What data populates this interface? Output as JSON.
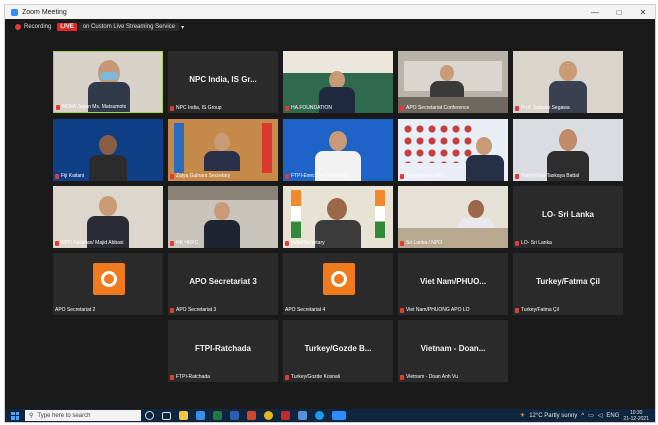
{
  "window": {
    "title": "Zoom Meeting",
    "minimize": "—",
    "maximize": "□",
    "close": "✕"
  },
  "toolbar": {
    "recording": "Recording",
    "live": "LIVE",
    "stream": "on Custom Live Streaming Service"
  },
  "tiles": [
    {
      "name": "MOFA Japan Ms. Matsumoto",
      "label": ""
    },
    {
      "name": "NPC India, IS Group",
      "label": "NPC India, IS Gr..."
    },
    {
      "name": "HA.FOUNDATION",
      "label": ""
    },
    {
      "name": "APO Secretariat Conference",
      "label": ""
    },
    {
      "name": "Prof. Sabano Segawa",
      "label": ""
    },
    {
      "name": "Fiji Kaitani",
      "label": ""
    },
    {
      "name": "Zaiya Gulnara Secretary",
      "label": ""
    },
    {
      "name": "FTPI-Executive Secretary",
      "label": ""
    },
    {
      "name": "Bangladesh-NPO",
      "label": ""
    },
    {
      "name": "Turkey/Gul Taskaya Battal",
      "label": ""
    },
    {
      "name": "NPO Pakistan/ Majid Abbasi",
      "label": ""
    },
    {
      "name": "HK HKPC",
      "label": ""
    },
    {
      "name": "India/Secretary",
      "label": ""
    },
    {
      "name": "Sri Lanka / NPO",
      "label": ""
    },
    {
      "name": "LO- Sri Lanka",
      "label": "LO- Sri Lanka"
    },
    {
      "name": "APO Secretariat 2",
      "label": ""
    },
    {
      "name": "APO Secretariat 3",
      "label": "APO Secretariat 3"
    },
    {
      "name": "APO Secretariat 4",
      "label": ""
    },
    {
      "name": "Viet Nam/PHUONG APO LO",
      "label": "Viet Nam/PHUO..."
    },
    {
      "name": "Turkey/Fatma Çil",
      "label": "Turkey/Fatma Çil"
    },
    {
      "name": "FTPI-Ratchada",
      "label": "FTPI-Ratchada"
    },
    {
      "name": "Turkey/Gozde Kosnali",
      "label": "Turkey/Gozde B..."
    },
    {
      "name": "Vietnam - Doan Anh Vu",
      "label": "Vietnam - Doan..."
    }
  ],
  "taskbar": {
    "search_placeholder": "Type here to search",
    "weather": "12°C  Partly sunny",
    "lang": "ENG",
    "time": "10:30",
    "date": "21-12-2021"
  },
  "colors": {
    "accent": "#2d8cff",
    "live": "#e02828",
    "apo_orange": "#f07a1e",
    "active_speaker": "#a3d44a"
  }
}
